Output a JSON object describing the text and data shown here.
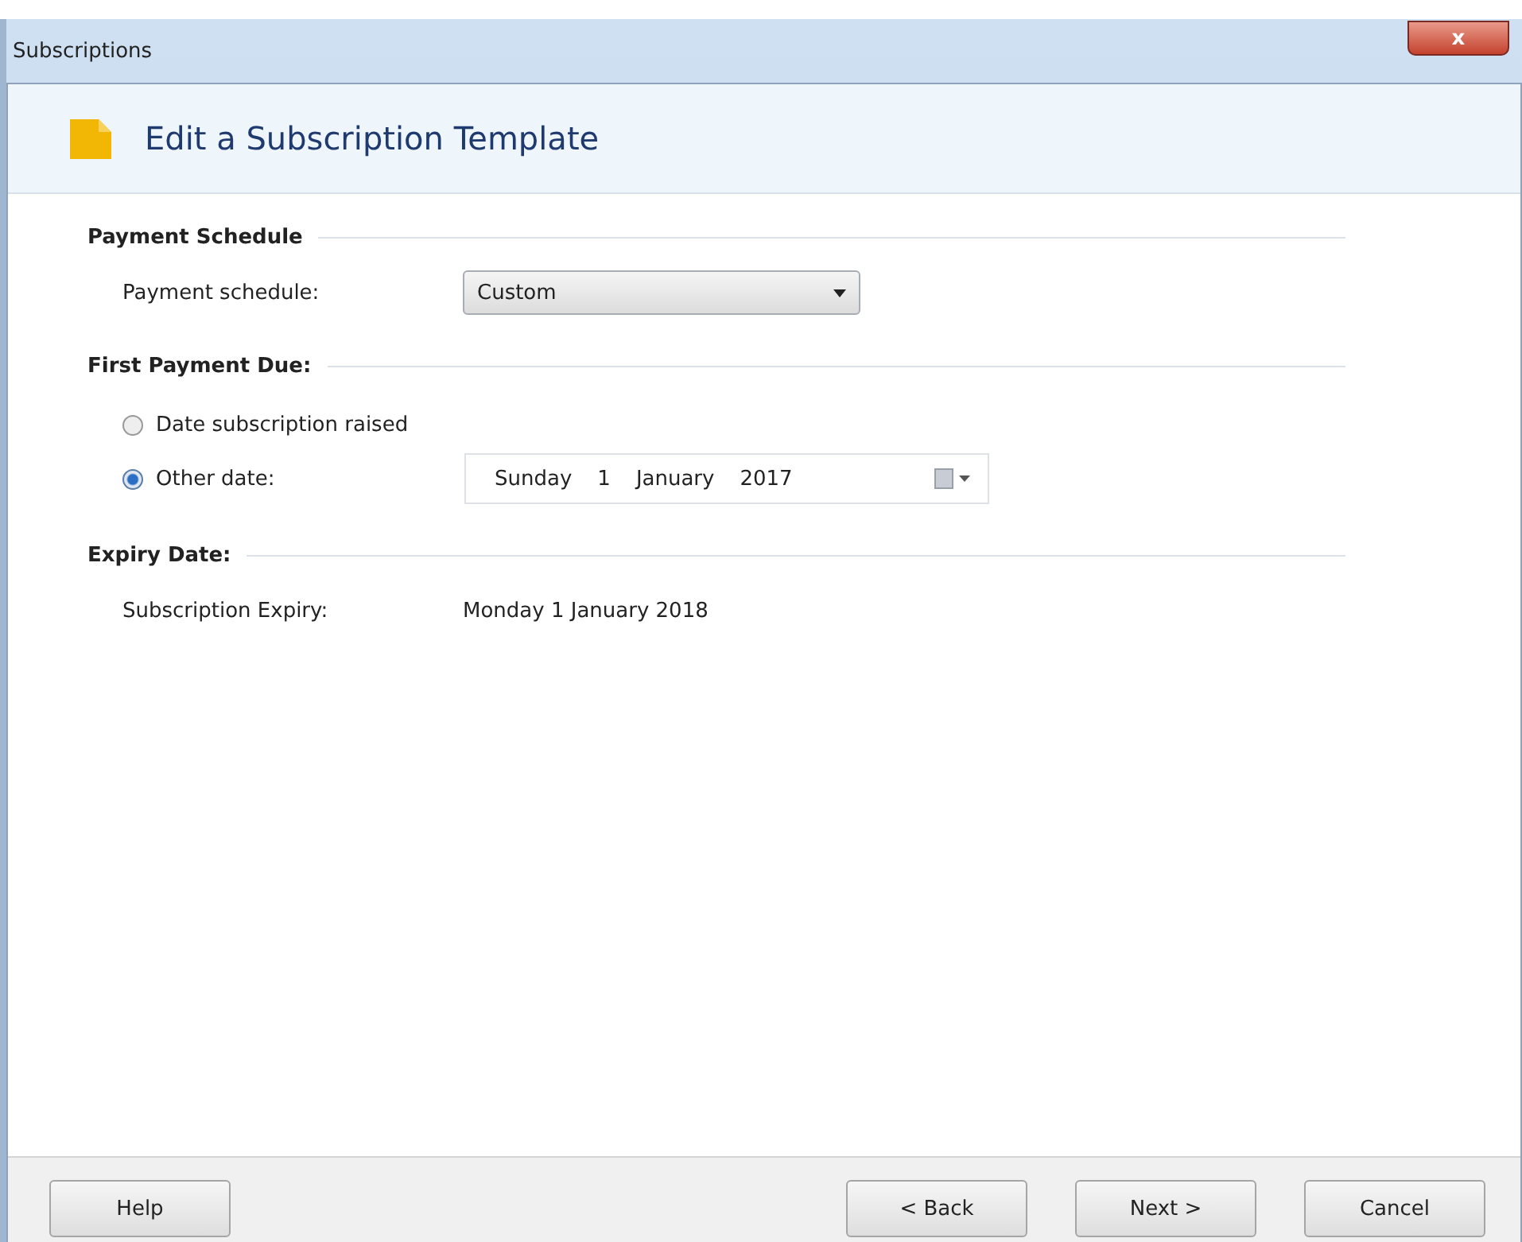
{
  "window": {
    "title": "Subscriptions",
    "close": "x"
  },
  "header": {
    "title": "Edit a Subscription Template"
  },
  "sections": [
    {
      "kind": "dropdown",
      "heading": "Payment Schedule",
      "label": "Payment schedule:",
      "value": "Custom"
    },
    {
      "kind": "radios",
      "heading": "First Payment Due:",
      "options": [
        {
          "label": "Date subscription raised",
          "selected": false
        },
        {
          "label": "Other date:",
          "selected": true,
          "date": [
            "Sunday",
            "1",
            "January",
            "2017"
          ]
        }
      ]
    },
    {
      "kind": "info",
      "heading": "Expiry Date:",
      "label": "Subscription Expiry:",
      "value": "Monday 1 January 2018"
    }
  ],
  "footer": {
    "left_buttons": [
      "Help"
    ],
    "right_buttons": [
      "< Back",
      "Next >",
      "Cancel"
    ]
  }
}
